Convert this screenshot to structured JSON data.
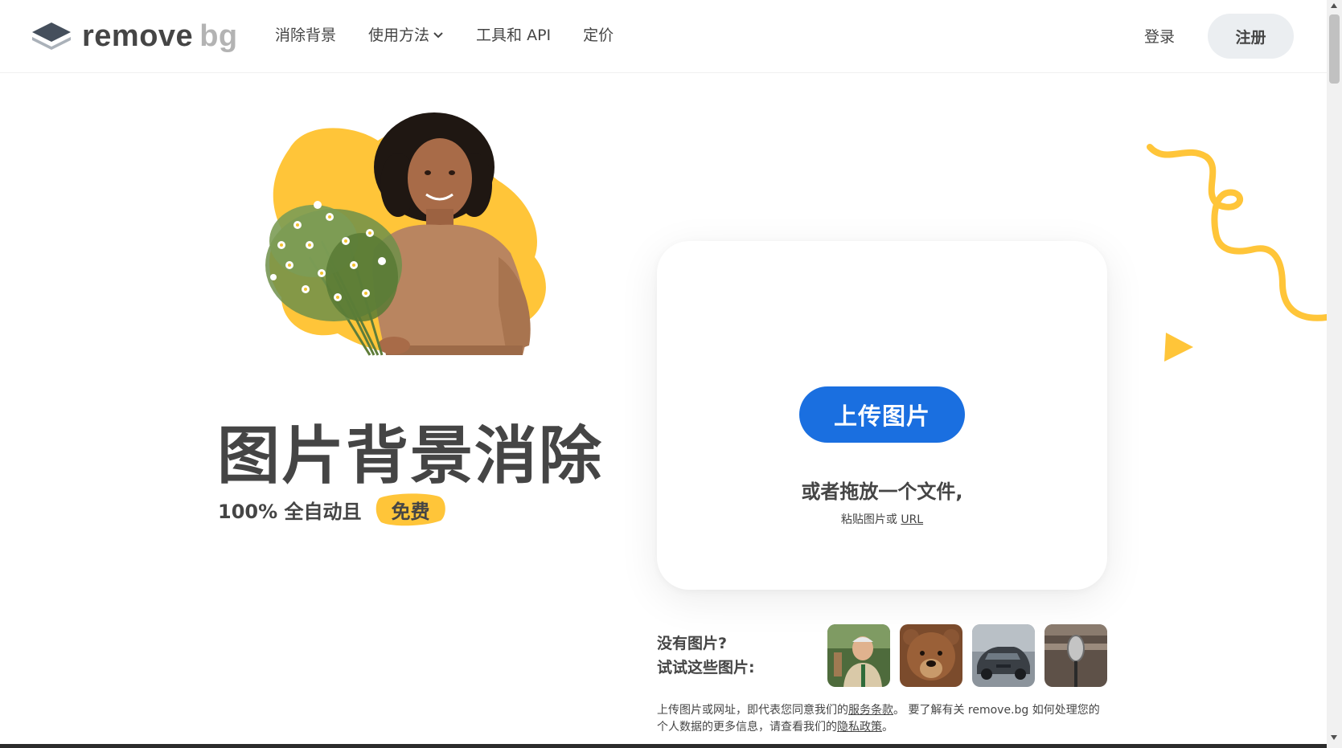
{
  "header": {
    "logo_remove": "remove",
    "logo_bg": "bg",
    "nav": [
      "消除背景",
      "使用方法",
      "工具和 API",
      "定价"
    ],
    "login_label": "登录",
    "signup_label": "注册"
  },
  "hero": {
    "title": "图片背景消除",
    "subtitle": "100% 全自动且",
    "badge": "免费"
  },
  "upload": {
    "button_label": "上传图片",
    "drop_text": "或者拖放一个文件,",
    "paste_prefix": "粘贴图片或",
    "paste_link": "URL"
  },
  "samples": {
    "label_line1": "没有图片?",
    "label_line2": "试试这些图片:",
    "items": [
      "man-photo",
      "bear-photo",
      "car-photo",
      "microphone-photo"
    ]
  },
  "legal": {
    "part1": "上传图片或网址，即代表您同意我们的",
    "terms_link": "服务条款",
    "part2": "。 要了解有关 remove.bg 如何处理您的个人数据的更多信息，请查看我们的",
    "privacy_link": "隐私政策",
    "part3": "。"
  },
  "colors": {
    "accent_blue": "#1a6fe0",
    "brand_yellow": "#ffc539",
    "text_dark": "#454545",
    "signup_bg": "#ebeef1"
  }
}
